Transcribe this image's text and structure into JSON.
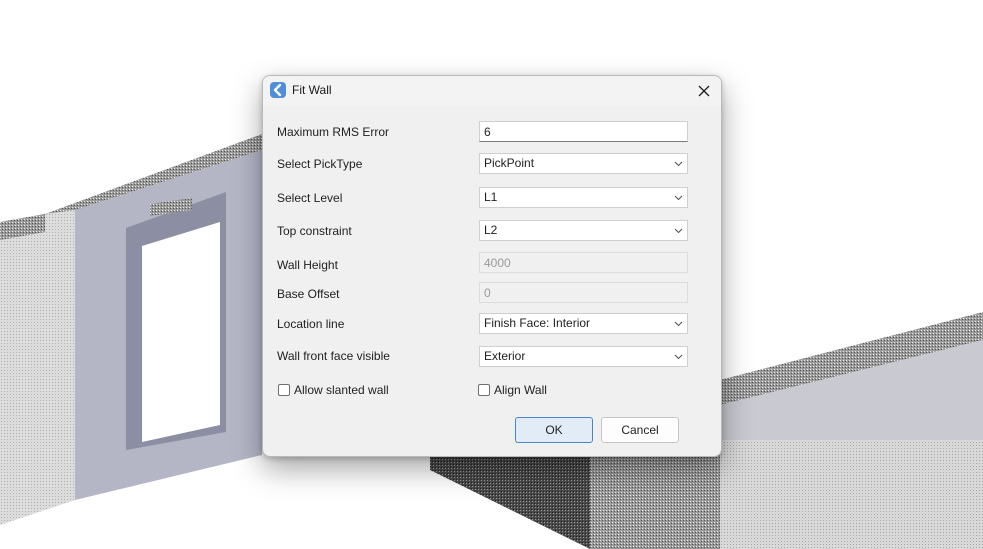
{
  "dialog": {
    "title": "Fit Wall",
    "max_rms": {
      "label": "Maximum RMS Error",
      "value": "6"
    },
    "pick_type": {
      "label": "Select PickType",
      "value": "PickPoint"
    },
    "level": {
      "label": "Select Level",
      "value": "L1"
    },
    "top_constraint": {
      "label": "Top constraint",
      "value": "L2"
    },
    "wall_height": {
      "label": "Wall Height",
      "value": "4000"
    },
    "base_offset": {
      "label": "Base Offset",
      "value": "0"
    },
    "location_line": {
      "label": "Location line",
      "value": "Finish Face: Interior"
    },
    "front_face": {
      "label": "Wall front face visible",
      "value": "Exterior"
    },
    "allow_slanted": {
      "label": "Allow slanted wall",
      "checked": false
    },
    "align_wall": {
      "label": "Align Wall",
      "checked": false
    },
    "ok_label": "OK",
    "cancel_label": "Cancel"
  },
  "icons": {
    "app": "fit-wall-app-icon",
    "close": "close-icon",
    "dropdown": "chevron-down-icon"
  },
  "colors": {
    "accent": "#4a86c7",
    "ok_fill": "#e1ecf7",
    "dialog_bg": "#f0f0f0"
  }
}
